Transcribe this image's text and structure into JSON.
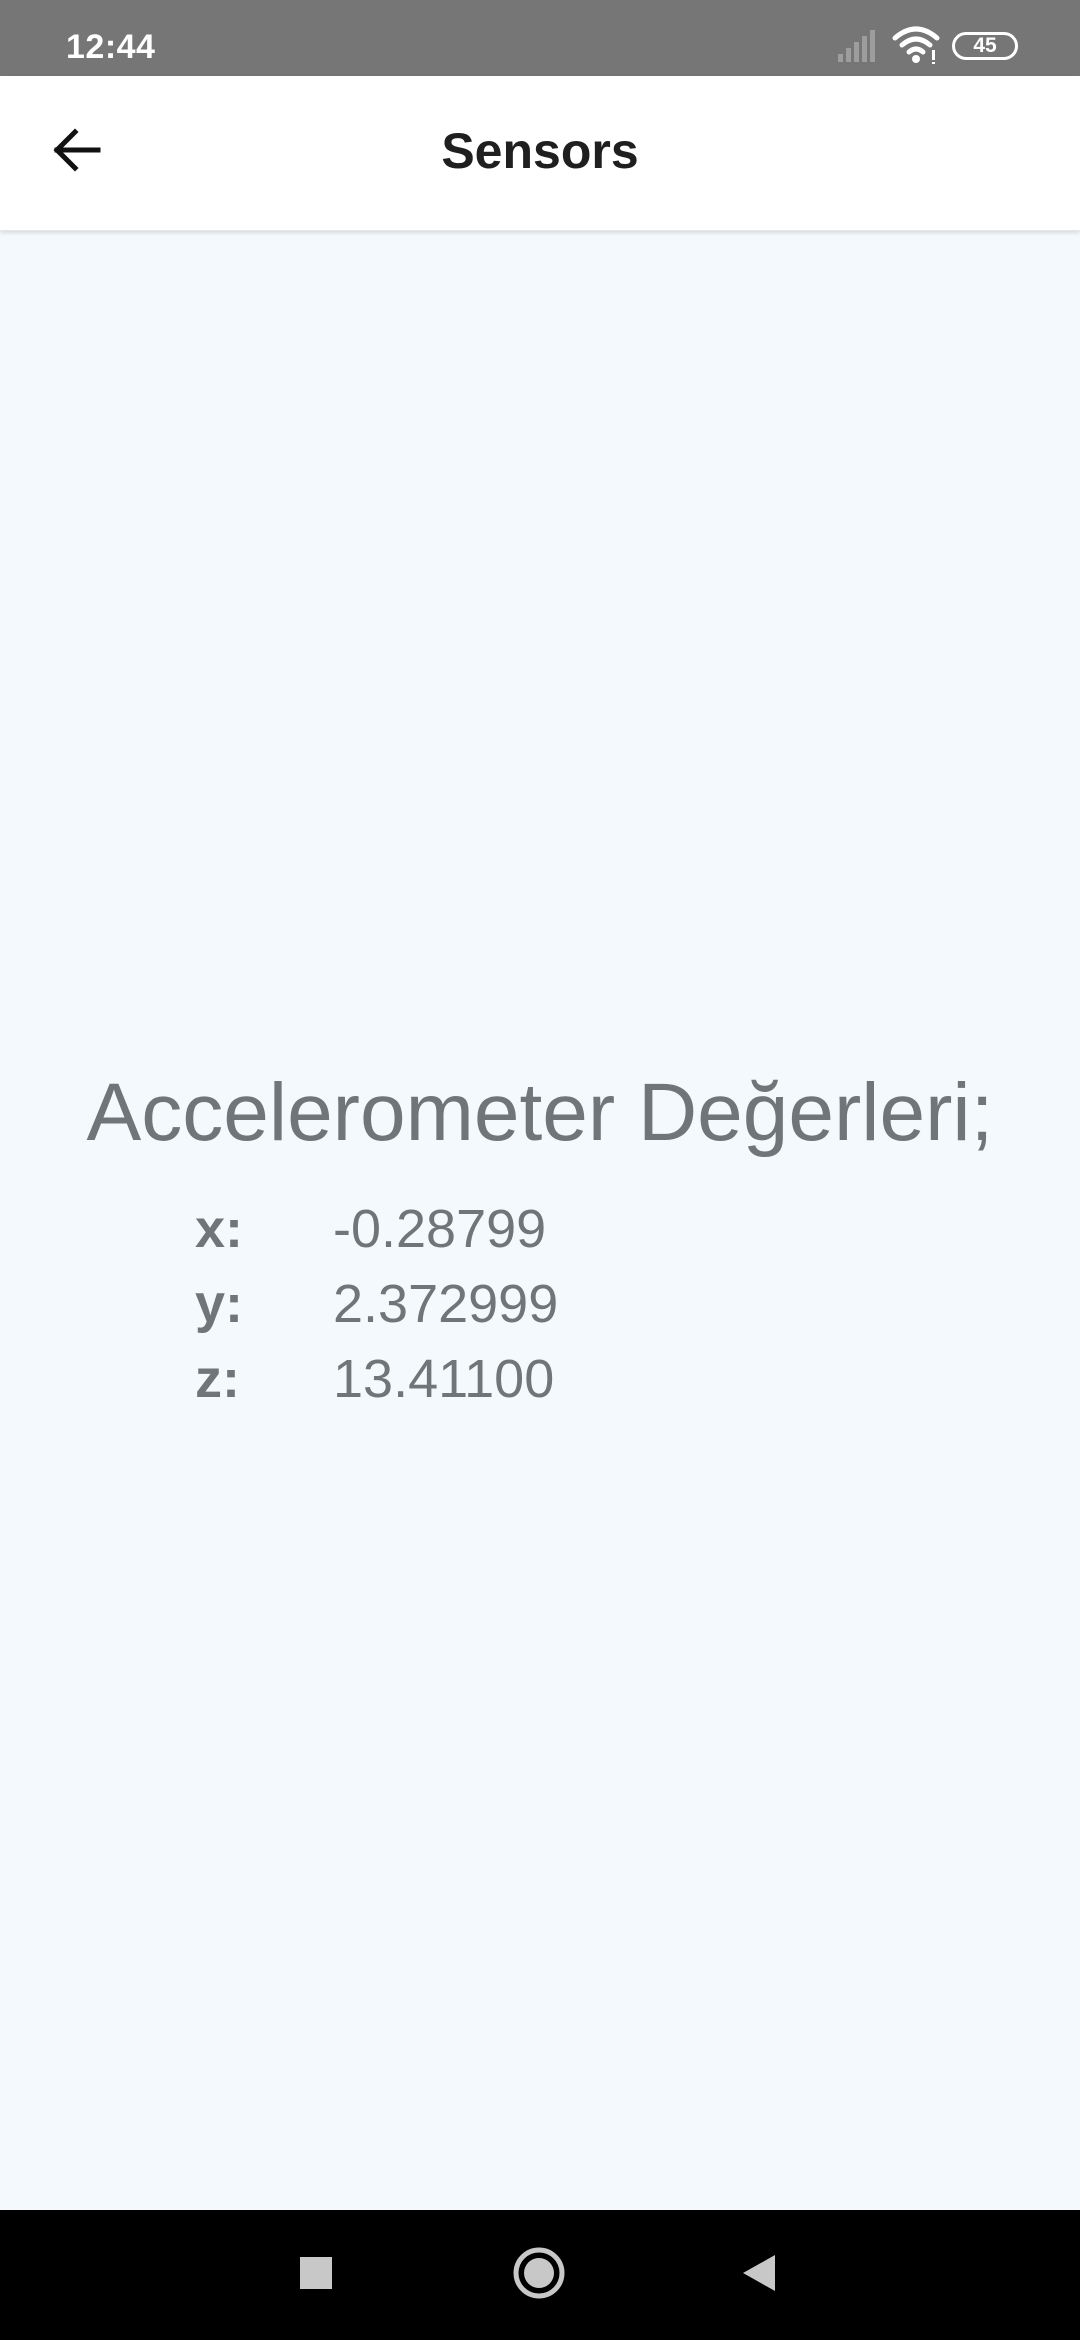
{
  "status_bar": {
    "time": "12:44",
    "battery_level": "45",
    "icons": [
      "signal-icon",
      "wifi-icon",
      "battery-icon"
    ]
  },
  "app_bar": {
    "title": "Sensors",
    "back_icon": "arrow-back-icon"
  },
  "sensor": {
    "heading": "Accelerometer Değerleri;",
    "readings": [
      {
        "axis": "x:",
        "value": "-0.28799"
      },
      {
        "axis": "y:",
        "value": "2.372999"
      },
      {
        "axis": "z:",
        "value": "13.41100"
      }
    ]
  },
  "nav_bar": {
    "icons": [
      "recents-square-icon",
      "home-circle-icon",
      "back-triangle-icon"
    ]
  },
  "colors": {
    "status_bar_bg": "#767676",
    "background": "#f3f9fc",
    "text_gray": "#717578",
    "title_text": "#1f1f1f",
    "nav_bar_bg": "#000000"
  }
}
